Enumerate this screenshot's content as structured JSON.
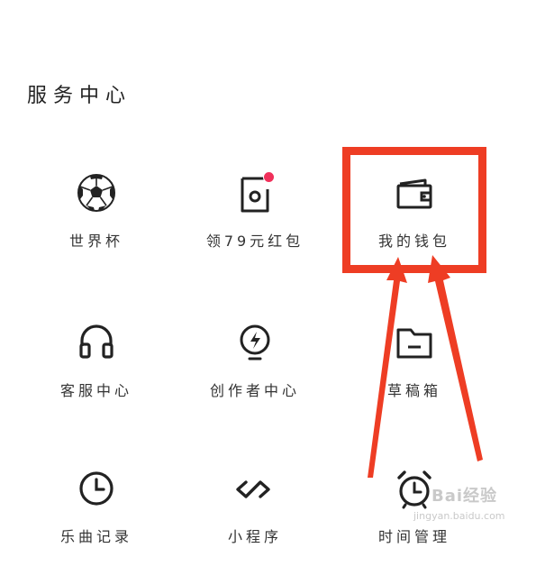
{
  "section": {
    "title": "服务中心"
  },
  "services": [
    {
      "label": "世界杯",
      "icon": "soccer-ball-icon"
    },
    {
      "label": "领79元红包",
      "icon": "red-packet-icon",
      "badge_color": "#f0305a"
    },
    {
      "label": "我的钱包",
      "icon": "wallet-icon"
    },
    {
      "label": "客服中心",
      "icon": "headset-icon"
    },
    {
      "label": "创作者中心",
      "icon": "lightning-bulb-icon"
    },
    {
      "label": "草稿箱",
      "icon": "folder-icon"
    },
    {
      "label": "乐曲记录",
      "icon": "clock-icon"
    },
    {
      "label": "小程序",
      "icon": "infinity-link-icon"
    },
    {
      "label": "时间管理",
      "icon": "alarm-clock-icon"
    }
  ],
  "annotation": {
    "color": "#ee3d24"
  },
  "watermark": {
    "brand": "Bai经验",
    "url": "jingyan.baidu.com"
  }
}
